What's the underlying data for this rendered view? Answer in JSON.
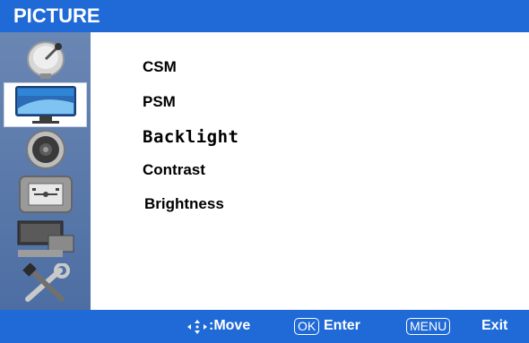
{
  "header": {
    "title": "PICTURE"
  },
  "sidebar": {
    "items": [
      {
        "icon": "satellite-dish-icon"
      },
      {
        "icon": "monitor-picture-icon",
        "active": true
      },
      {
        "icon": "speaker-icon"
      },
      {
        "icon": "timer-panel-icon"
      },
      {
        "icon": "pc-setup-icon"
      },
      {
        "icon": "tools-icon"
      }
    ]
  },
  "menu": {
    "items": [
      {
        "label": "CSM"
      },
      {
        "label": "PSM"
      },
      {
        "label": "Backlight"
      },
      {
        "label": "Contrast"
      },
      {
        "label": "Brightness"
      }
    ]
  },
  "footer": {
    "move_label": ":Move",
    "ok_key": "OK",
    "enter_label": "Enter",
    "menu_key": "MENU",
    "exit_label": "Exit"
  },
  "colors": {
    "bar": "#1f6ad6",
    "sidebar": "#5a79ab"
  }
}
